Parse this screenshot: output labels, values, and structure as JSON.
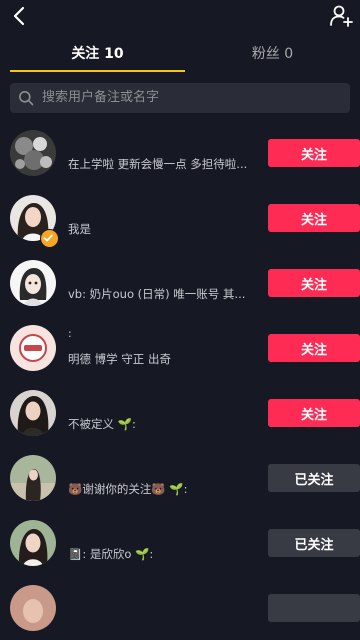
{
  "tabs": {
    "following": "关注 10",
    "fans": "粉丝 0"
  },
  "search": {
    "placeholder": "搜索用户备注或名字"
  },
  "users": [
    {
      "signature": "在上学啦 更新会慢一点 多担待啦...",
      "name": "",
      "button": "关注",
      "state": "follow"
    },
    {
      "signature": "我是",
      "name": "",
      "button": "关注",
      "state": "follow",
      "verified": true
    },
    {
      "signature": "vb: 奶片ouo (日常) 唯一账号 其...",
      "name": "",
      "button": "关注",
      "state": "follow"
    },
    {
      "signature": "明德 博学 守正 出奇",
      "name": ":",
      "button": "关注",
      "state": "follow"
    },
    {
      "signature": "不被定义 🌱:",
      "name": "",
      "button": "关注",
      "state": "follow"
    },
    {
      "signature": "🐻谢谢你的关注🐻 🌱:",
      "name": "",
      "button": "已关注",
      "state": "followed"
    },
    {
      "signature": "📓: 是欣欣o 🌱:",
      "name": "",
      "button": "已关注",
      "state": "followed"
    }
  ],
  "icons": {
    "back": "chevron-left-icon",
    "add_friend": "add-user-icon",
    "search": "search-icon"
  },
  "colors": {
    "accent": "#fe2c55",
    "tab_indicator": "#f5c518",
    "background": "#161823"
  }
}
